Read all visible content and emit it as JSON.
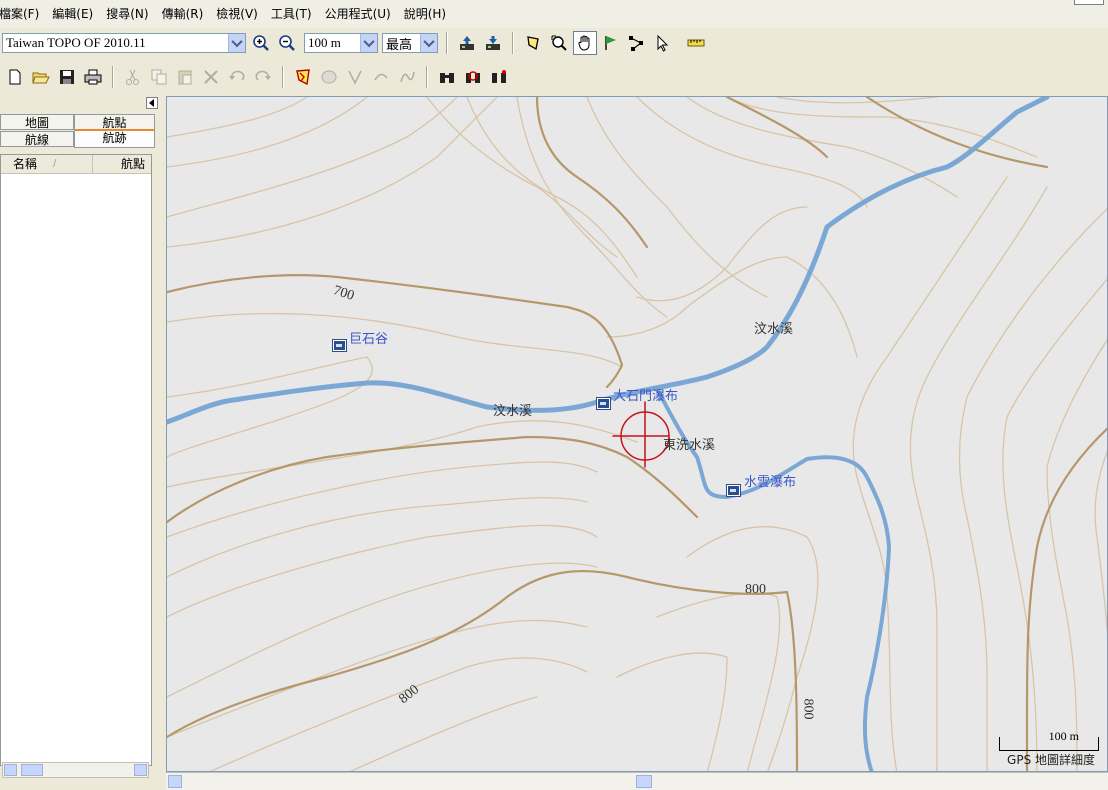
{
  "menu": [
    "檔案(F)",
    "編輯(E)",
    "搜尋(N)",
    "傳輸(R)",
    "檢視(V)",
    "工具(T)",
    "公用程式(U)",
    "說明(H)"
  ],
  "toolbar": {
    "map_product": "Taiwan TOPO OF 2010.11",
    "zoom_scale": "100 m",
    "detail_level": "最高"
  },
  "left_panel": {
    "tabs": {
      "map": "地圖",
      "waypoints": "航點",
      "routes": "航線",
      "tracks": "航跡"
    },
    "columns": {
      "name": "名稱",
      "waypoint": "航點"
    }
  },
  "map": {
    "labels": {
      "juxigu": "巨石谷",
      "wenshui_w": "汶水溪",
      "wenshui_ne": "汶水溪",
      "dashimen": "大石門瀑布",
      "dongxi": "東洗水溪",
      "shuiyun": "水雲瀑布"
    },
    "contours": {
      "c700": "700",
      "c800_center": "800",
      "c800_left": "800",
      "c800_right": "800"
    },
    "scale_label": "100 m",
    "detail_caption": "GPS 地圖詳細度"
  },
  "colors": {
    "contour_major": "#b5976a",
    "contour_minor": "#d8c4a6",
    "water": "#7ba7d4",
    "poi": "#3a56c8",
    "cursor": "#c8101e"
  }
}
